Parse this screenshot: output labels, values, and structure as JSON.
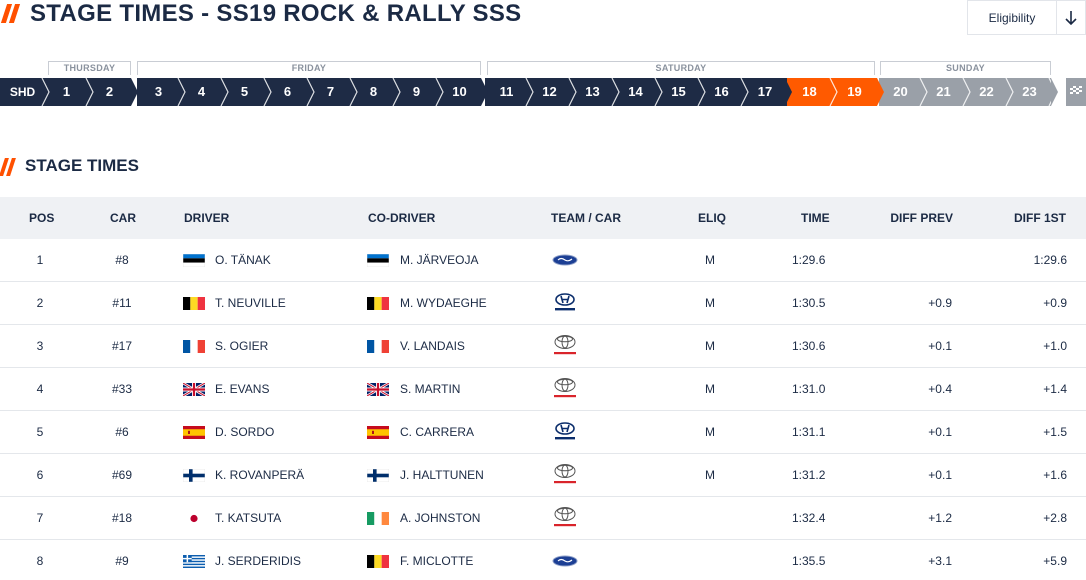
{
  "header": {
    "title": "STAGE TIMES - SS19 ROCK & RALLY SSS",
    "eligibility_label": "Eligibility"
  },
  "days": [
    "THURSDAY",
    "FRIDAY",
    "SATURDAY",
    "SUNDAY"
  ],
  "stages": [
    "SHD",
    "1",
    "2",
    "3",
    "4",
    "5",
    "6",
    "7",
    "8",
    "9",
    "10",
    "11",
    "12",
    "13",
    "14",
    "15",
    "16",
    "17",
    "18",
    "19",
    "20",
    "21",
    "22",
    "23"
  ],
  "selected_stage": "19",
  "section": {
    "title": "STAGE TIMES"
  },
  "columns": {
    "pos": "POS",
    "car": "CAR",
    "driver": "DRIVER",
    "codriver": "CO-DRIVER",
    "team": "TEAM / CAR",
    "eliq": "ELIQ",
    "time": "TIME",
    "diff_prev": "DIFF PREV",
    "diff_first": "DIFF 1ST"
  },
  "rows": [
    {
      "pos": "1",
      "car": "#8",
      "driver": "O. TÄNAK",
      "driver_flag": "estonia-flag",
      "codriver": "M. JÄRVEOJA",
      "codriver_flag": "estonia-flag",
      "team_logo": "ford-logo",
      "eliq": "M",
      "time": "1:29.6",
      "diff_prev": "",
      "diff_first": "1:29.6"
    },
    {
      "pos": "2",
      "car": "#11",
      "driver": "T. NEUVILLE",
      "driver_flag": "belgium-flag",
      "codriver": "M. WYDAEGHE",
      "codriver_flag": "belgium-flag",
      "team_logo": "hyundai-logo",
      "eliq": "M",
      "time": "1:30.5",
      "diff_prev": "+0.9",
      "diff_first": "+0.9"
    },
    {
      "pos": "3",
      "car": "#17",
      "driver": "S. OGIER",
      "driver_flag": "france-flag",
      "codriver": "V. LANDAIS",
      "codriver_flag": "france-flag",
      "team_logo": "toyota-logo",
      "eliq": "M",
      "time": "1:30.6",
      "diff_prev": "+0.1",
      "diff_first": "+1.0"
    },
    {
      "pos": "4",
      "car": "#33",
      "driver": "E. EVANS",
      "driver_flag": "uk-flag",
      "codriver": "S. MARTIN",
      "codriver_flag": "uk-flag",
      "team_logo": "toyota-logo",
      "eliq": "M",
      "time": "1:31.0",
      "diff_prev": "+0.4",
      "diff_first": "+1.4"
    },
    {
      "pos": "5",
      "car": "#6",
      "driver": "D. SORDO",
      "driver_flag": "spain-flag",
      "codriver": "C. CARRERA",
      "codriver_flag": "spain-flag",
      "team_logo": "hyundai-logo",
      "eliq": "M",
      "time": "1:31.1",
      "diff_prev": "+0.1",
      "diff_first": "+1.5"
    },
    {
      "pos": "6",
      "car": "#69",
      "driver": "K. ROVANPERÄ",
      "driver_flag": "finland-flag",
      "codriver": "J. HALTTUNEN",
      "codriver_flag": "finland-flag",
      "team_logo": "toyota-logo",
      "eliq": "M",
      "time": "1:31.2",
      "diff_prev": "+0.1",
      "diff_first": "+1.6"
    },
    {
      "pos": "7",
      "car": "#18",
      "driver": "T. KATSUTA",
      "driver_flag": "japan-flag",
      "codriver": "A. JOHNSTON",
      "codriver_flag": "ireland-flag",
      "team_logo": "toyota-logo",
      "eliq": "",
      "time": "1:32.4",
      "diff_prev": "+1.2",
      "diff_first": "+2.8"
    },
    {
      "pos": "8",
      "car": "#9",
      "driver": "J. SERDERIDIS",
      "driver_flag": "greece-flag",
      "codriver": "F. MICLOTTE",
      "codriver_flag": "belgium-flag",
      "team_logo": "ford-logo",
      "eliq": "",
      "time": "1:35.5",
      "diff_prev": "+3.1",
      "diff_first": "+5.9"
    }
  ],
  "colors": {
    "navy": "#1e2b45",
    "accent": "#ff5a00",
    "future": "#9aa0a8"
  },
  "icons": {
    "download": "download-arrow-icon",
    "finish": "checkered-flag-icon"
  }
}
